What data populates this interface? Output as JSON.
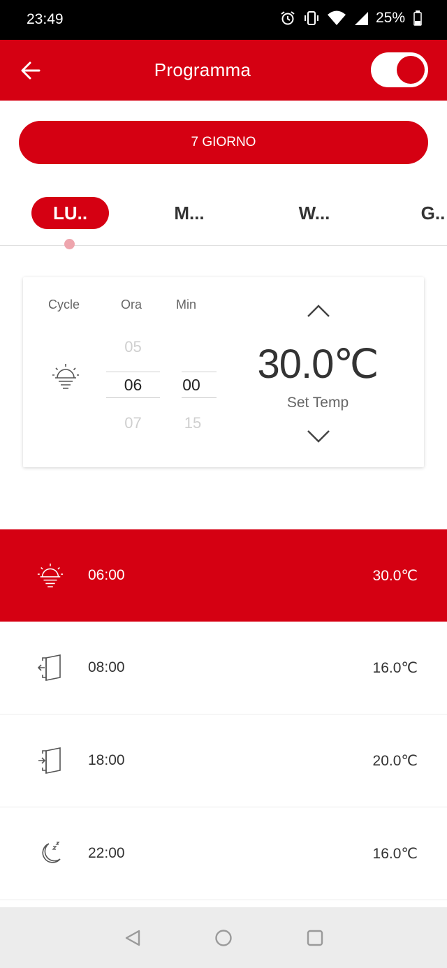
{
  "status_bar": {
    "time": "23:49",
    "battery": "25%"
  },
  "header": {
    "title": "Programma",
    "toggle_on": true
  },
  "mode_button": {
    "label": "7 GIORNO"
  },
  "day_tabs": [
    {
      "label": "LU..",
      "active": true
    },
    {
      "label": "M...",
      "active": false
    },
    {
      "label": "W...",
      "active": false
    },
    {
      "label": "G..",
      "active": false
    }
  ],
  "editor": {
    "cycle_label": "Cycle",
    "hour_label": "Ora",
    "minute_label": "Min",
    "hours": {
      "prev": "05",
      "selected": "06",
      "next": "07"
    },
    "minutes": {
      "prev": "",
      "selected": "00",
      "next": "15"
    },
    "temperature": "30.0℃",
    "temperature_label": "Set Temp",
    "cycle_icon": "sun-rise-icon"
  },
  "schedule": [
    {
      "icon": "sun-rise-icon",
      "time": "06:00",
      "temp": "30.0℃",
      "active": true
    },
    {
      "icon": "door-exit-icon",
      "time": "08:00",
      "temp": "16.0℃",
      "active": false
    },
    {
      "icon": "door-enter-icon",
      "time": "18:00",
      "temp": "20.0℃",
      "active": false
    },
    {
      "icon": "moon-sleep-icon",
      "time": "22:00",
      "temp": "16.0℃",
      "active": false
    }
  ],
  "colors": {
    "brand": "#d50012",
    "indicator": "#eea5ad"
  }
}
